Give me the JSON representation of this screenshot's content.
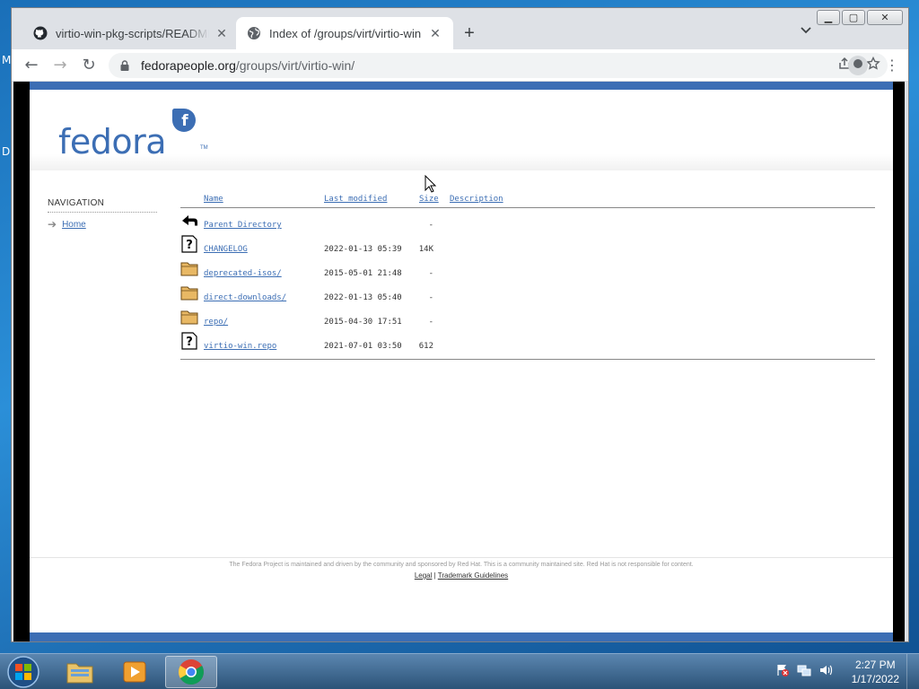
{
  "desktop": {
    "stray_chars": [
      "M",
      "D"
    ]
  },
  "browser": {
    "window_controls": {
      "minimize": "▁",
      "maximize": "▢",
      "close": "✕"
    },
    "tabs": [
      {
        "title": "virtio-win-pkg-scripts/README.md",
        "favicon": "github-icon",
        "active": false
      },
      {
        "title": "Index of /groups/virt/virtio-win",
        "favicon": "globe-icon",
        "active": true
      }
    ],
    "new_tab": "+",
    "tab_search": "⌄",
    "nav": {
      "back": "←",
      "forward": "→",
      "reload": "↻"
    },
    "url": {
      "host": "fedorapeople.org",
      "path": "/groups/virt/virtio-win/"
    },
    "menu": "⋮"
  },
  "page": {
    "logo_text": "fedora",
    "logo_glyph": "f",
    "logo_tm": "TM",
    "navigation": {
      "heading": "NAVIGATION",
      "items": [
        {
          "label": "Home",
          "arrow": "➔"
        }
      ]
    },
    "listing": {
      "headers": {
        "name": "Name",
        "modified": "Last modified",
        "size": "Size",
        "description": "Description"
      },
      "rows": [
        {
          "icon": "back-arrow-icon",
          "name": "Parent Directory",
          "modified": "",
          "size": "-"
        },
        {
          "icon": "unknown-file-icon",
          "name": "CHANGELOG",
          "modified": "2022-01-13 05:39",
          "size": "14K"
        },
        {
          "icon": "folder-icon",
          "name": "deprecated-isos/",
          "modified": "2015-05-01 21:48",
          "size": "-"
        },
        {
          "icon": "folder-icon",
          "name": "direct-downloads/",
          "modified": "2022-01-13 05:40",
          "size": "-"
        },
        {
          "icon": "folder-icon",
          "name": "repo/",
          "modified": "2015-04-30 17:51",
          "size": "-"
        },
        {
          "icon": "unknown-file-icon",
          "name": "virtio-win.repo",
          "modified": "2021-07-01 03:50",
          "size": "612"
        }
      ]
    },
    "footer": {
      "text": "The Fedora Project is maintained and driven by the community and sponsored by Red Hat. This is a community maintained site. Red Hat is not responsible for content.",
      "links": [
        "Legal",
        "Trademark Guidelines"
      ],
      "separator": "|"
    },
    "colors": {
      "fedora_blue": "#3c6eb4"
    }
  },
  "taskbar": {
    "clock_time": "2:27 PM",
    "clock_date": "1/17/2022",
    "pinned": [
      "explorer-icon",
      "media-player-icon",
      "chrome-icon"
    ]
  }
}
